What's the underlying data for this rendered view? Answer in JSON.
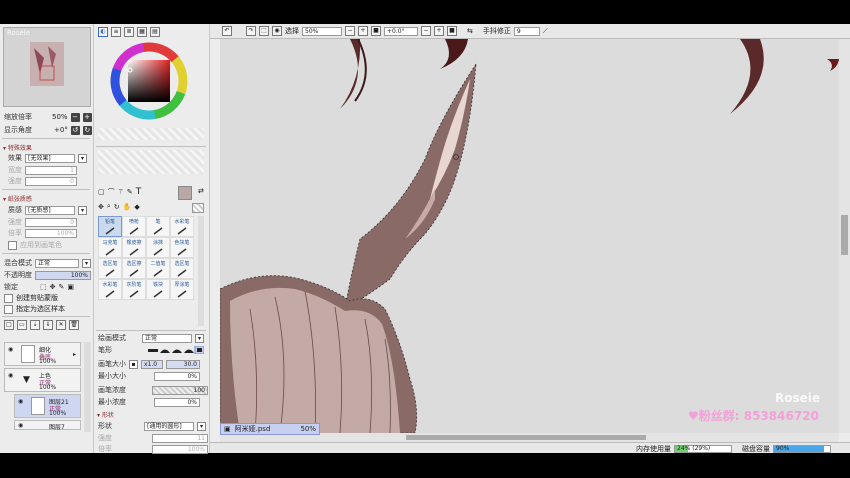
{
  "watermark_top": "Rosele",
  "watermark_bottom": "Roseie",
  "navigator": {
    "zoom_label": "缩放倍率",
    "zoom_value": "50%",
    "angle_label": "显示角度",
    "angle_value": "+0°"
  },
  "effects": {
    "header": "特殊效果",
    "effect_label": "效果",
    "effect_value": "[无效果]",
    "width_label": "宽度",
    "width_value": "1",
    "strength_label": "强度",
    "strength_value": "0"
  },
  "paper": {
    "header": "纸张质感",
    "texture_label": "质感",
    "texture_value": "[无质感]",
    "strength_label": "强度",
    "strength_value": "0",
    "scale_label": "倍率",
    "scale_value": "100%",
    "apply_label": "应用到画笔色"
  },
  "layer_props": {
    "blend_label": "混合模式",
    "blend_value": "正常",
    "opacity_label": "不透明度",
    "opacity_value": "100%",
    "lock_label": "锁定",
    "clip_label": "创建剪贴蒙版",
    "sample_label": "指定为选区样本"
  },
  "layers": [
    {
      "name": "细化",
      "mode": "叠底",
      "opacity": "100%"
    },
    {
      "name": "上色",
      "mode": "正常",
      "opacity": "100%"
    },
    {
      "name": "图层21",
      "mode": "正常",
      "opacity": "100%"
    },
    {
      "name": "图层7",
      "mode": "",
      "opacity": ""
    }
  ],
  "tools_header_icons": [
    "pick",
    "line",
    "grid",
    "table",
    "layers"
  ],
  "brushes": [
    {
      "label": "铅笔",
      "selected": true
    },
    {
      "label": "喷枪",
      "selected": false
    },
    {
      "label": "笔",
      "selected": false
    },
    {
      "label": "水彩笔",
      "selected": false
    },
    {
      "label": "马克笔",
      "selected": false
    },
    {
      "label": "橡皮擦",
      "selected": false
    },
    {
      "label": "涂抹",
      "selected": false
    },
    {
      "label": "色块笔",
      "selected": false
    },
    {
      "label": "选区笔",
      "selected": false
    },
    {
      "label": "选区擦",
      "selected": false
    },
    {
      "label": "二值笔",
      "selected": false
    },
    {
      "label": "选区笔",
      "selected": false
    },
    {
      "label": "水彩笔",
      "selected": false
    },
    {
      "label": "灰阶笔",
      "selected": false
    },
    {
      "label": "铁块",
      "selected": false
    },
    {
      "label": "厚涂笔",
      "selected": false
    }
  ],
  "brush_settings": {
    "draw_mode_label": "绘画模式",
    "draw_mode_value": "正常",
    "shape_label": "笔形",
    "size_label": "画笔大小",
    "size_multiplier": "x1.0",
    "size_value": "30.0",
    "min_size_label": "最小大小",
    "min_size_value": "0%",
    "density_label": "画笔浓度",
    "density_value": "100",
    "min_density_label": "最小浓度",
    "min_density_value": "0%",
    "shape_section": "形状",
    "shape2_label": "形状",
    "shape2_value": "[通用的圆形]",
    "strength_label": "强度",
    "strength_value": "11",
    "scale_label": "倍率",
    "scale_value": "100%"
  },
  "toolbar": {
    "select_label": "选择",
    "zoom": "50%",
    "rotation": "+0.0°",
    "stabilizer_label": "手抖修正",
    "stabilizer_value": "9"
  },
  "status": {
    "document_name": "阿米娅.psd",
    "document_zoom": "50%",
    "memory_label": "内存使用量",
    "memory_value": "24% (29%)",
    "memory_percent": 24,
    "disk_label": "磁盘容量",
    "disk_value": "90%",
    "disk_percent": 90
  },
  "fan_banner": "♥粉丝群: 853846720",
  "colors": {
    "accent": "#3a6ad0",
    "memory_bar": "#6fd06f",
    "disk_bar": "#4aa6e8",
    "fan_text": "#f5a0d8",
    "ear_fill": "#8a6a66"
  }
}
